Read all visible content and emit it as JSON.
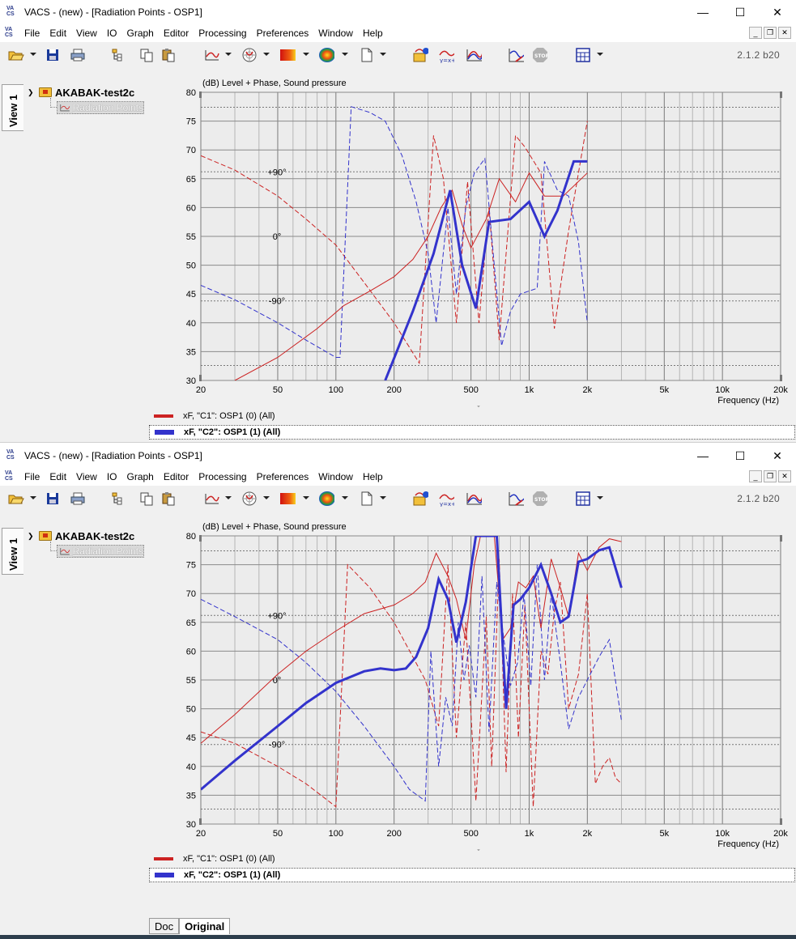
{
  "window": {
    "title": "VACS - (new) - [Radiation Points - OSP1]",
    "app_icon_text": [
      "VA",
      "CS"
    ],
    "controls": {
      "minimize": "—",
      "maximize": "☐",
      "close": "✕"
    },
    "mdi_controls": {
      "minimize": "_",
      "restore": "❐",
      "close": "✕"
    }
  },
  "menu": [
    "File",
    "Edit",
    "View",
    "IO",
    "Graph",
    "Editor",
    "Processing",
    "Preferences",
    "Window",
    "Help"
  ],
  "version": "2.1.2 b20",
  "side_tab": "View 1",
  "tree": {
    "project": "AKABAK-test2c",
    "child": "Radiation Points"
  },
  "graph_title": "(dB)  Level + Phase, Sound pressure",
  "legend": [
    {
      "label": "xF, \"C1\": OSP1 (0)  (All)",
      "color": "#cc2222",
      "selected": false
    },
    {
      "label": "xF, \"C2\": OSP1 (1)  (All)",
      "color": "#3333cc",
      "selected": true
    }
  ],
  "bottom_tabs": [
    "Doc",
    "Original"
  ],
  "chart_data": [
    {
      "type": "line",
      "xscale": "log",
      "xlim": [
        20,
        20000
      ],
      "ylim": [
        30,
        80
      ],
      "ylabel": "(dB)",
      "xlabel": "Frequency  (Hz)",
      "y_ticks": [
        30,
        35,
        40,
        45,
        50,
        55,
        60,
        65,
        70,
        75,
        80
      ],
      "x_tick_labels": [
        {
          "v": 20,
          "t": "20"
        },
        {
          "v": 50,
          "t": "50"
        },
        {
          "v": 100,
          "t": "100"
        },
        {
          "v": 200,
          "t": "200"
        },
        {
          "v": 500,
          "t": "500"
        },
        {
          "v": 1000,
          "t": "1k"
        },
        {
          "v": 2000,
          "t": "2k"
        },
        {
          "v": 5000,
          "t": "5k"
        },
        {
          "v": 10000,
          "t": "10k"
        },
        {
          "v": 20000,
          "t": "20k"
        }
      ],
      "phase_labels": [
        {
          "label": "+90°",
          "y": 66.2
        },
        {
          "label": "0°",
          "y": 55.0
        },
        {
          "label": "-90°",
          "y": 43.8
        }
      ],
      "phase_dotted_lines": [
        77.4,
        66.2,
        43.8,
        32.6
      ],
      "series": [
        {
          "name": "xF, \"C1\": OSP1 (0)  (All)",
          "kind": "level",
          "color": "#cc2222",
          "x": [
            30,
            50,
            80,
            110,
            150,
            200,
            250,
            300,
            350,
            400,
            450,
            500,
            600,
            700,
            850,
            1000,
            1200,
            1500,
            2000
          ],
          "y": [
            30,
            34,
            39,
            43,
            45.5,
            48,
            51,
            55,
            60,
            63,
            57,
            53,
            58,
            65,
            61,
            66,
            62,
            62,
            66
          ]
        },
        {
          "name": "C1 phase",
          "kind": "phase",
          "color": "#cc2222",
          "x": [
            20,
            30,
            50,
            70,
            100,
            140,
            200,
            270,
            320,
            360,
            420,
            480,
            550,
            620,
            700,
            850,
            950,
            1150,
            1350,
            1600,
            2000
          ],
          "y": [
            69,
            66.5,
            62,
            58,
            53.5,
            47,
            40,
            33,
            72.5,
            65,
            40,
            64.5,
            40,
            60,
            37,
            72.5,
            70.5,
            66,
            39,
            56,
            75
          ]
        },
        {
          "name": "xF, \"C2\": OSP1 (1)  (All)",
          "kind": "level",
          "color": "#3333cc",
          "x": [
            180,
            250,
            320,
            390,
            450,
            530,
            620,
            800,
            1000,
            1200,
            1400,
            1700,
            2000
          ],
          "y": [
            30,
            42,
            52,
            63,
            50,
            42.5,
            57.5,
            58,
            61,
            55,
            59.5,
            68,
            68
          ]
        },
        {
          "name": "C2 phase",
          "kind": "phase",
          "color": "#3333cc",
          "x": [
            20,
            30,
            50,
            70,
            100,
            105,
            120,
            150,
            180,
            220,
            260,
            300,
            330,
            380,
            420,
            470,
            520,
            590,
            640,
            720,
            800,
            900,
            1100,
            1200,
            1400,
            1600,
            1800,
            2000
          ],
          "y": [
            46.5,
            44,
            40,
            37,
            34,
            34,
            77.5,
            76.5,
            75,
            69,
            61,
            52,
            40,
            60,
            45,
            60,
            66,
            68.5,
            55,
            36,
            42,
            45,
            46,
            68,
            63,
            62,
            54,
            40
          ]
        }
      ]
    },
    {
      "type": "line",
      "xscale": "log",
      "xlim": [
        20,
        20000
      ],
      "ylim": [
        30,
        80
      ],
      "ylabel": "(dB)",
      "xlabel": "Frequency  (Hz)",
      "y_ticks": [
        30,
        35,
        40,
        45,
        50,
        55,
        60,
        65,
        70,
        75,
        80
      ],
      "x_tick_labels": [
        {
          "v": 20,
          "t": "20"
        },
        {
          "v": 50,
          "t": "50"
        },
        {
          "v": 100,
          "t": "100"
        },
        {
          "v": 200,
          "t": "200"
        },
        {
          "v": 500,
          "t": "500"
        },
        {
          "v": 1000,
          "t": "1k"
        },
        {
          "v": 2000,
          "t": "2k"
        },
        {
          "v": 5000,
          "t": "5k"
        },
        {
          "v": 10000,
          "t": "10k"
        },
        {
          "v": 20000,
          "t": "20k"
        }
      ],
      "phase_labels": [
        {
          "label": "+90°",
          "y": 66.2
        },
        {
          "label": "0°",
          "y": 55.0
        },
        {
          "label": "-90°",
          "y": 43.8
        }
      ],
      "phase_dotted_lines": [
        77.4,
        66.2,
        43.8,
        32.6
      ],
      "series": [
        {
          "name": "xF, \"C1\": OSP1 (0)  (All)",
          "kind": "level",
          "color": "#cc2222",
          "x": [
            20,
            30,
            50,
            70,
            100,
            140,
            200,
            250,
            290,
            330,
            380,
            420,
            470,
            520,
            560,
            610,
            660,
            730,
            800,
            880,
            960,
            1050,
            1150,
            1300,
            1450,
            1600,
            1800,
            2000,
            2300,
            2600,
            3000
          ],
          "y": [
            44,
            49,
            56,
            60,
            63.5,
            66.5,
            68,
            70,
            72,
            77,
            73,
            69,
            62,
            75,
            80,
            80,
            80,
            62,
            64,
            72,
            71,
            73,
            64,
            76,
            71,
            66,
            77,
            74,
            78,
            79.5,
            79
          ]
        },
        {
          "name": "C1 phase",
          "kind": "phase",
          "color": "#cc2222",
          "x": [
            20,
            30,
            50,
            70,
            100,
            115,
            150,
            200,
            250,
            290,
            340,
            380,
            420,
            470,
            530,
            600,
            640,
            700,
            760,
            820,
            880,
            950,
            1050,
            1150,
            1250,
            1350,
            1450,
            1600,
            1800,
            2000,
            2200,
            2400,
            2600,
            2800,
            3000
          ],
          "y": [
            46,
            44,
            40,
            37,
            33,
            75,
            71,
            65,
            59,
            55,
            47,
            75,
            45,
            65,
            34,
            66,
            40,
            76,
            39,
            70,
            45,
            68,
            33,
            60,
            56,
            67,
            72,
            50,
            56,
            70,
            37,
            40,
            41.5,
            38,
            37
          ]
        },
        {
          "name": "xF, \"C2\": OSP1 (1)  (All)",
          "kind": "level",
          "color": "#3333cc",
          "x": [
            20,
            30,
            50,
            70,
            100,
            140,
            170,
            200,
            230,
            260,
            300,
            340,
            380,
            420,
            470,
            530,
            600,
            680,
            760,
            830,
            900,
            1000,
            1150,
            1300,
            1450,
            1600,
            1800,
            2000,
            2300,
            2600,
            3000
          ],
          "y": [
            36,
            41,
            47,
            51,
            54.5,
            56.5,
            57,
            56.7,
            57,
            59,
            64,
            72.5,
            69,
            61.5,
            68.5,
            80,
            80,
            80,
            50,
            68,
            69,
            71,
            75,
            70,
            65,
            66,
            75.5,
            76,
            77.5,
            78,
            71
          ]
        },
        {
          "name": "C2 phase",
          "kind": "phase",
          "color": "#3333cc",
          "x": [
            20,
            30,
            50,
            70,
            100,
            140,
            200,
            240,
            290,
            310,
            340,
            370,
            400,
            430,
            460,
            490,
            530,
            570,
            620,
            680,
            740,
            800,
            870,
            940,
            1020,
            1100,
            1200,
            1300,
            1450,
            1600,
            1800,
            2000,
            2300,
            2600,
            3000
          ],
          "y": [
            69,
            66,
            62,
            58,
            53,
            47,
            40,
            36,
            34,
            60,
            40,
            52,
            47,
            65,
            55,
            61,
            52,
            73,
            46,
            72,
            62,
            54,
            58,
            70,
            54,
            75,
            55,
            70,
            58,
            46.5,
            52,
            55,
            59,
            62,
            48
          ]
        }
      ]
    }
  ]
}
